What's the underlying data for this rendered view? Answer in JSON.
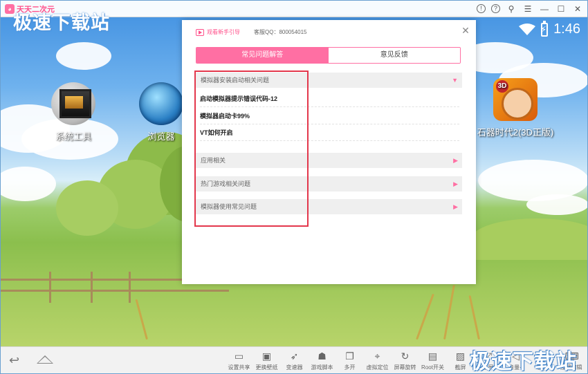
{
  "titlebar": {
    "app_name": "天天二次元",
    "watermark": "极速下载站",
    "controls": [
      "!",
      "?",
      "⚲",
      "☰",
      "—",
      "☐",
      "✕"
    ]
  },
  "statusbar": {
    "time": "1:46"
  },
  "desktop": {
    "icons": [
      {
        "label": "系统工具",
        "icon": "system-tools-icon"
      },
      {
        "label": "浏览器",
        "icon": "browser-icon"
      },
      {
        "label": "石器时代2(3D正版)",
        "icon": "stone-age-game-icon"
      }
    ]
  },
  "dialog": {
    "guide_link": "观看新手引导",
    "qq": "客服QQ：800054015",
    "tabs": [
      {
        "label": "常见问题解答",
        "active": true
      },
      {
        "label": "意见反馈",
        "active": false
      }
    ],
    "sections": [
      {
        "title": "模拟器安装启动相关问题",
        "expanded": true,
        "items": [
          "启动模拟器提示错误代码-12",
          "模拟器启动卡99%",
          "VT如何开启"
        ]
      },
      {
        "title": "应用相关",
        "expanded": false
      },
      {
        "title": "热门游戏相关问题",
        "expanded": false
      },
      {
        "title": "模拟器使用常见问题",
        "expanded": false
      }
    ]
  },
  "bottombar": {
    "tools": [
      {
        "label": "设置共享",
        "icon": "folder-icon"
      },
      {
        "label": "更换壁纸",
        "icon": "image-icon"
      },
      {
        "label": "变速器",
        "icon": "rocket-icon"
      },
      {
        "label": "游戏脚本",
        "icon": "script-icon"
      },
      {
        "label": "多开",
        "icon": "multi-window-icon"
      },
      {
        "label": "虚拟定位",
        "icon": "location-pin-icon"
      },
      {
        "label": "屏幕旋转",
        "icon": "rotate-icon"
      },
      {
        "label": "Root开关",
        "icon": "root-switch-icon"
      },
      {
        "label": "截屏",
        "icon": "screenshot-icon"
      },
      {
        "label": "全屏",
        "icon": "fullscreen-icon"
      },
      {
        "label": "音量+",
        "icon": "volume-up-icon"
      },
      {
        "label": "音量-",
        "icon": "volume-down-icon"
      },
      {
        "label": "按键编辑",
        "icon": "keymap-icon"
      }
    ],
    "watermark": "极速下载站"
  },
  "colors": {
    "accent": "#ff6fa3",
    "highlight_box": "#e3364b"
  }
}
